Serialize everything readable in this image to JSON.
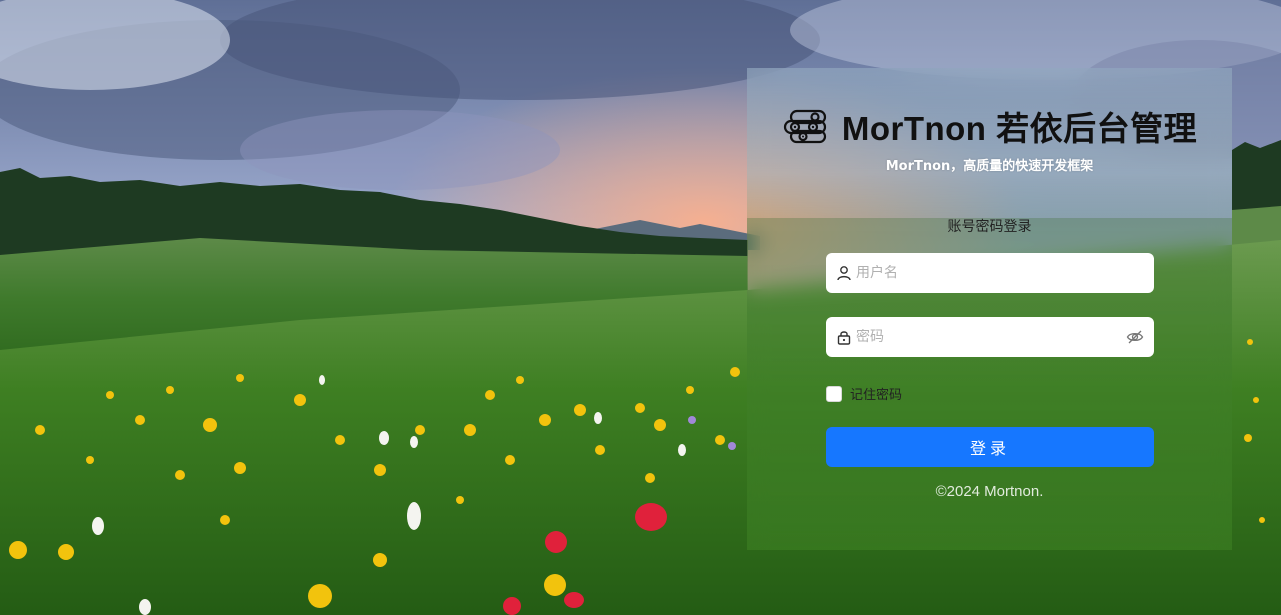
{
  "brand": {
    "logo_icon": "logs-icon",
    "title": "MorTnon 若依后台管理",
    "subtitle": "MorTnon，高质量的快速开发框架"
  },
  "login": {
    "tab_label": "账号密码登录",
    "username_placeholder": "用户名",
    "password_placeholder": "密码",
    "user_icon": "user-icon",
    "lock_icon": "lock-icon",
    "visibility_icon": "eye-off-icon",
    "remember_label": "记住密码",
    "remember_checked": false,
    "submit_label": "登录",
    "submit_color": "#1677ff"
  },
  "footer": {
    "copyright": "©2024 Mortnon."
  }
}
